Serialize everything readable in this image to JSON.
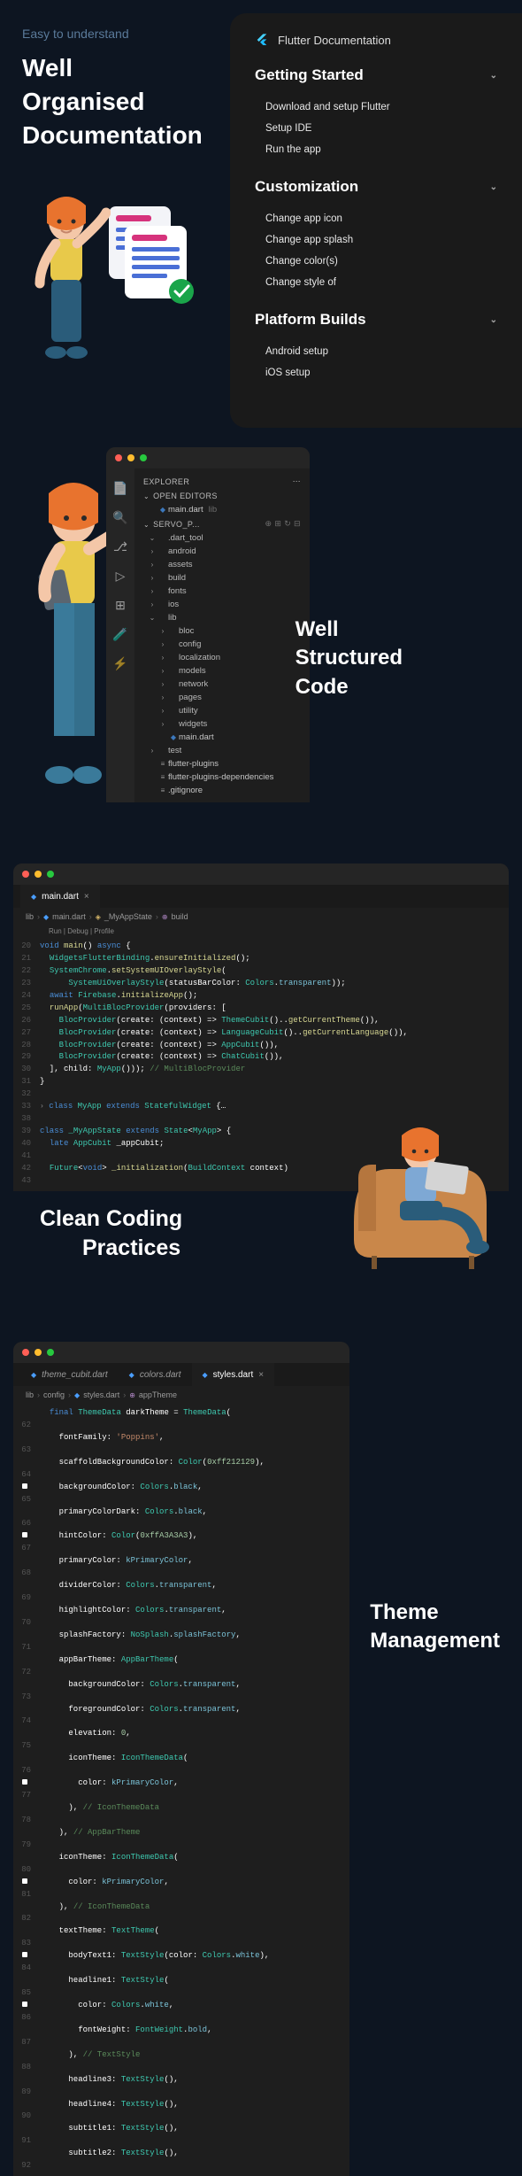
{
  "section1": {
    "subtitle": "Easy to understand",
    "title_l1": "Well",
    "title_l2": "Organised",
    "title_l3": "Documentation"
  },
  "doc_panel": {
    "brand": "Flutter Documentation",
    "sections": [
      {
        "title": "Getting Started",
        "items": [
          "Download and setup Flutter",
          "Setup IDE",
          "Run the app"
        ]
      },
      {
        "title": "Customization",
        "items": [
          "Change app icon",
          "Change app splash",
          "Change color(s)",
          "Change style of"
        ]
      },
      {
        "title": "Platform Builds",
        "items": [
          "Android setup",
          "iOS setup"
        ]
      }
    ]
  },
  "explorer": {
    "title": "EXPLORER",
    "open_editors": "OPEN EDITORS",
    "open_file": "main.dart",
    "open_file_suffix": "lib",
    "project": "SERVO_P...",
    "tree": [
      {
        "d": 0,
        "t": "folder",
        "open": true,
        "name": ".dart_tool"
      },
      {
        "d": 0,
        "t": "folder",
        "name": "android"
      },
      {
        "d": 0,
        "t": "folder",
        "name": "assets"
      },
      {
        "d": 0,
        "t": "folder",
        "name": "build"
      },
      {
        "d": 0,
        "t": "folder",
        "name": "fonts"
      },
      {
        "d": 0,
        "t": "folder",
        "name": "ios"
      },
      {
        "d": 0,
        "t": "folder",
        "open": true,
        "name": "lib"
      },
      {
        "d": 1,
        "t": "folder",
        "name": "bloc"
      },
      {
        "d": 1,
        "t": "folder",
        "name": "config"
      },
      {
        "d": 1,
        "t": "folder",
        "name": "localization"
      },
      {
        "d": 1,
        "t": "folder",
        "name": "models"
      },
      {
        "d": 1,
        "t": "folder",
        "name": "network"
      },
      {
        "d": 1,
        "t": "folder",
        "name": "pages"
      },
      {
        "d": 1,
        "t": "folder",
        "name": "utility"
      },
      {
        "d": 1,
        "t": "folder",
        "name": "widgets"
      },
      {
        "d": 1,
        "t": "file",
        "name": "main.dart"
      },
      {
        "d": 0,
        "t": "folder",
        "name": "test"
      },
      {
        "d": 0,
        "t": "file",
        "name": "flutter-plugins"
      },
      {
        "d": 0,
        "t": "file",
        "name": "flutter-plugins-dependencies"
      },
      {
        "d": 0,
        "t": "file",
        "name": ".gitignore"
      }
    ]
  },
  "section2_title_l1": "Well",
  "section2_title_l2": "Structured",
  "section2_title_l3": "Code",
  "editor1": {
    "filename": "main.dart",
    "crumbs": [
      "lib",
      "main.dart",
      "_MyAppState",
      "build"
    ],
    "debug_label": "Run | Debug | Profile",
    "lines": [
      {
        "n": 20,
        "html": "<span class='kw'>void</span> <span class='fn'>main</span>() <span class='kw'>async</span> {"
      },
      {
        "n": 21,
        "html": "  <span class='cls'>WidgetsFlutterBinding</span>.<span class='fn'>ensureInitialized</span>();"
      },
      {
        "n": 22,
        "html": "  <span class='cls'>SystemChrome</span>.<span class='fn'>setSystemUIOverlayStyle</span>("
      },
      {
        "n": 23,
        "html": "      <span class='cls'>SystemUiOverlayStyle</span>(statusBarColor: <span class='cls'>Colors</span>.<span class='pr'>transparent</span>));"
      },
      {
        "n": 24,
        "html": "  <span class='kw'>await</span> <span class='cls'>Firebase</span>.<span class='fn'>initializeApp</span>();"
      },
      {
        "n": 25,
        "html": "  <span class='fn'>runApp</span>(<span class='cls'>MultiBlocProvider</span>(providers: ["
      },
      {
        "n": 26,
        "html": "    <span class='cls'>BlocProvider</span>(create: (context) => <span class='cls'>ThemeCubit</span>()..<span class='fn'>getCurrentTheme</span>()),"
      },
      {
        "n": 27,
        "html": "    <span class='cls'>BlocProvider</span>(create: (context) => <span class='cls'>LanguageCubit</span>()..<span class='fn'>getCurrentLanguage</span>()),"
      },
      {
        "n": 28,
        "html": "    <span class='cls'>BlocProvider</span>(create: (context) => <span class='cls'>AppCubit</span>()),"
      },
      {
        "n": 29,
        "html": "    <span class='cls'>BlocProvider</span>(create: (context) => <span class='cls'>ChatCubit</span>()),"
      },
      {
        "n": 30,
        "html": "  ], child: <span class='cls'>MyApp</span>())); <span class='com'>// MultiBlocProvider</span>"
      },
      {
        "n": 31,
        "html": "}"
      },
      {
        "n": 32,
        "html": ""
      },
      {
        "n": 33,
        "html": "<span class='kw'>class</span> <span class='cls'>MyApp</span> <span class='kw'>extends</span> <span class='cls'>StatefulWidget</span> {…",
        "fold": true
      },
      {
        "n": 38,
        "html": ""
      },
      {
        "n": 39,
        "html": "<span class='kw'>class</span> <span class='cls'>_MyAppState</span> <span class='kw'>extends</span> <span class='cls'>State</span>&lt;<span class='cls'>MyApp</span>&gt; {"
      },
      {
        "n": 40,
        "html": "  <span class='kw'>late</span> <span class='cls'>AppCubit</span> _appCubit;"
      },
      {
        "n": 41,
        "html": ""
      },
      {
        "n": 42,
        "html": "  <span class='cls'>Future</span>&lt;<span class='kw'>void</span>&gt; <span class='fn'>_initialization</span>(<span class='cls'>BuildContext</span> context)"
      },
      {
        "n": 43,
        "html": ""
      }
    ]
  },
  "section3_title_l1": "Clean Coding",
  "section3_title_l2": "Practices",
  "editor2": {
    "tabs": [
      {
        "name": "theme_cubit.dart",
        "active": false
      },
      {
        "name": "colors.dart",
        "active": false
      },
      {
        "name": "styles.dart",
        "active": true
      }
    ],
    "crumbs": [
      "lib",
      "config",
      "styles.dart",
      "appTheme"
    ],
    "lines": [
      {
        "n": 62,
        "html": "  <span class='kw'>final</span> <span class='cls'>ThemeData</span> darkTheme = <span class='cls'>ThemeData</span>("
      },
      {
        "n": 63,
        "html": "    fontFamily: <span class='str'>'Poppins'</span>,"
      },
      {
        "n": 64,
        "html": "    scaffoldBackgroundColor: <span class='cls'>Color</span>(<span class='num'>0xff212129</span>),"
      },
      {
        "n": 65,
        "dot": true,
        "html": "    backgroundColor: <span class='cls'>Colors</span>.<span class='pr'>black</span>,"
      },
      {
        "n": 66,
        "html": "    primaryColorDark: <span class='cls'>Colors</span>.<span class='pr'>black</span>,"
      },
      {
        "n": 67,
        "dot": true,
        "html": "    hintColor: <span class='cls'>Color</span>(<span class='num'>0xffA3A3A3</span>),"
      },
      {
        "n": 68,
        "html": "    primaryColor: <span class='pr'>kPrimaryColor</span>,"
      },
      {
        "n": 69,
        "html": "    dividerColor: <span class='cls'>Colors</span>.<span class='pr'>transparent</span>,"
      },
      {
        "n": 70,
        "html": "    highlightColor: <span class='cls'>Colors</span>.<span class='pr'>transparent</span>,"
      },
      {
        "n": 71,
        "html": "    splashFactory: <span class='cls'>NoSplash</span>.<span class='pr'>splashFactory</span>,"
      },
      {
        "n": 72,
        "html": "    appBarTheme: <span class='cls'>AppBarTheme</span>("
      },
      {
        "n": 73,
        "html": "      backgroundColor: <span class='cls'>Colors</span>.<span class='pr'>transparent</span>,"
      },
      {
        "n": 74,
        "html": "      foregroundColor: <span class='cls'>Colors</span>.<span class='pr'>transparent</span>,"
      },
      {
        "n": 75,
        "html": "      elevation: <span class='num'>0</span>,"
      },
      {
        "n": 76,
        "html": "      iconTheme: <span class='cls'>IconThemeData</span>("
      },
      {
        "n": 77,
        "dot": true,
        "html": "        color: <span class='pr'>kPrimaryColor</span>,"
      },
      {
        "n": 78,
        "html": "      ), <span class='com'>// IconThemeData</span>"
      },
      {
        "n": 79,
        "html": "    ), <span class='com'>// AppBarTheme</span>"
      },
      {
        "n": 80,
        "html": "    iconTheme: <span class='cls'>IconThemeData</span>("
      },
      {
        "n": 81,
        "dot": true,
        "html": "      color: <span class='pr'>kPrimaryColor</span>,"
      },
      {
        "n": 82,
        "html": "    ), <span class='com'>// IconThemeData</span>"
      },
      {
        "n": 83,
        "html": "    textTheme: <span class='cls'>TextTheme</span>("
      },
      {
        "n": 84,
        "dot": true,
        "html": "      bodyText1: <span class='cls'>TextStyle</span>(color: <span class='cls'>Colors</span>.<span class='pr'>white</span>),"
      },
      {
        "n": 85,
        "html": "      headline1: <span class='cls'>TextStyle</span>("
      },
      {
        "n": 86,
        "dot": true,
        "html": "        color: <span class='cls'>Colors</span>.<span class='pr'>white</span>,"
      },
      {
        "n": 87,
        "html": "        fontWeight: <span class='cls'>FontWeight</span>.<span class='pr'>bold</span>,"
      },
      {
        "n": 88,
        "html": "      ), <span class='com'>// TextStyle</span>"
      },
      {
        "n": 89,
        "html": "      headline3: <span class='cls'>TextStyle</span>(),"
      },
      {
        "n": 90,
        "html": "      headline4: <span class='cls'>TextStyle</span>(),"
      },
      {
        "n": 91,
        "html": "      subtitle1: <span class='cls'>TextStyle</span>(),"
      },
      {
        "n": 92,
        "html": "      subtitle2: <span class='cls'>TextStyle</span>(),"
      }
    ]
  },
  "section4_title_l1": "Theme",
  "section4_title_l2": "Management"
}
